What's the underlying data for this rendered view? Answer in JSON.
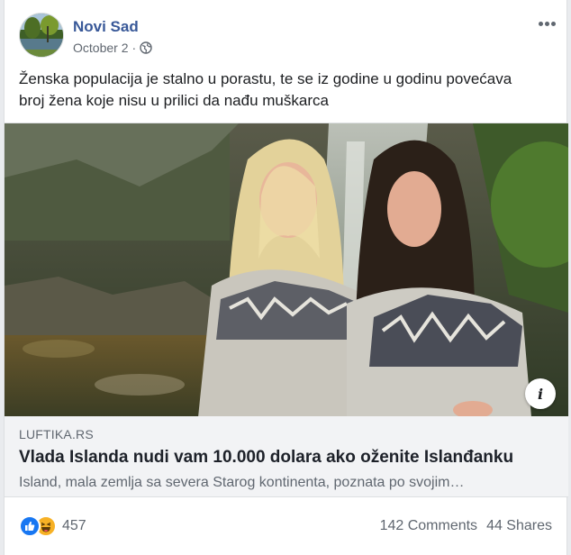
{
  "post": {
    "page_name": "Novi Sad",
    "date": "October 2",
    "separator": "·",
    "text": "Ženska populacija je stalno u porastu, te se iz godine u godinu povećava broj žena koje nisu u prilici da nađu muškarca"
  },
  "icons": {
    "avatar": "lake-photo-avatar",
    "audience": "globe-icon",
    "menu": "more-options-icon",
    "info": "info-icon",
    "reactions": [
      "like-icon",
      "haha-icon"
    ]
  },
  "link": {
    "domain": "LUFTIKA.RS",
    "title": "Vlada Islanda nudi vam 10.000 dolara ako oženite Islanđanku",
    "description": "Island, mala zemlja sa severa Starog kontinenta, poznata po svojim…",
    "info_label": "i"
  },
  "footer": {
    "reaction_count": "457",
    "comments": "142 Comments",
    "shares": "44 Shares"
  },
  "colors": {
    "page_name": "#385898",
    "secondary_text": "#606770",
    "caption_bg": "#f2f3f5",
    "like_blue": "#1877f2",
    "haha_yellow": "#f7b125"
  }
}
